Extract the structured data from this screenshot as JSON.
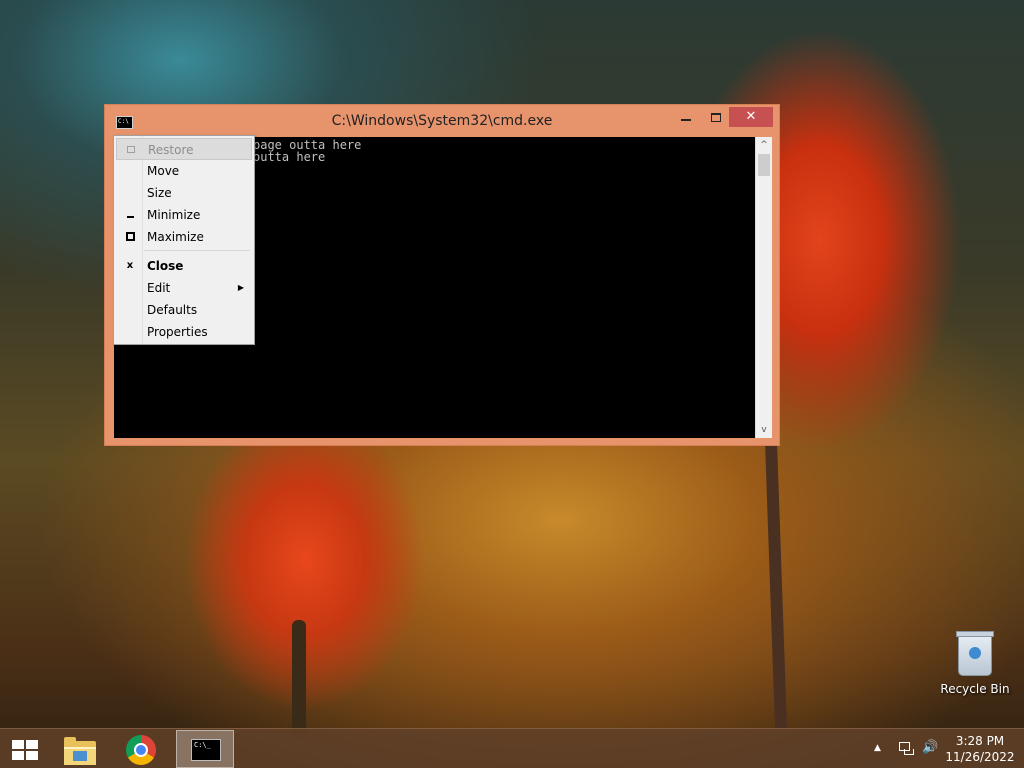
{
  "window": {
    "title": "C:\\Windows\\System32\\cmd.exe",
    "icon_text": "C:\\",
    "close_glyph": "✕"
  },
  "console": {
    "lines": [
      "",
      "page outta here",
      "outta here"
    ]
  },
  "system_menu": {
    "items": [
      {
        "label": "Restore",
        "enabled": false,
        "icon": "restore-icon"
      },
      {
        "label": "Move",
        "enabled": true
      },
      {
        "label": "Size",
        "enabled": true
      },
      {
        "label": "Minimize",
        "enabled": true,
        "icon": "minimize-icon"
      },
      {
        "label": "Maximize",
        "enabled": true,
        "icon": "maximize-icon"
      },
      {
        "label": "Close",
        "enabled": true,
        "icon": "close-icon",
        "bold": true,
        "glyph": "x"
      },
      {
        "label": "Edit",
        "enabled": true,
        "submenu": true,
        "arrow": "▶"
      },
      {
        "label": "Defaults",
        "enabled": true
      },
      {
        "label": "Properties",
        "enabled": true
      }
    ]
  },
  "desktop": {
    "recycle_bin_label": "Recycle Bin"
  },
  "taskbar": {
    "cmd_icon_text": "C:\\_",
    "tray_arrow": "▲",
    "volume_glyph": "🔊",
    "time": "3:28 PM",
    "date": "11/26/2022"
  }
}
